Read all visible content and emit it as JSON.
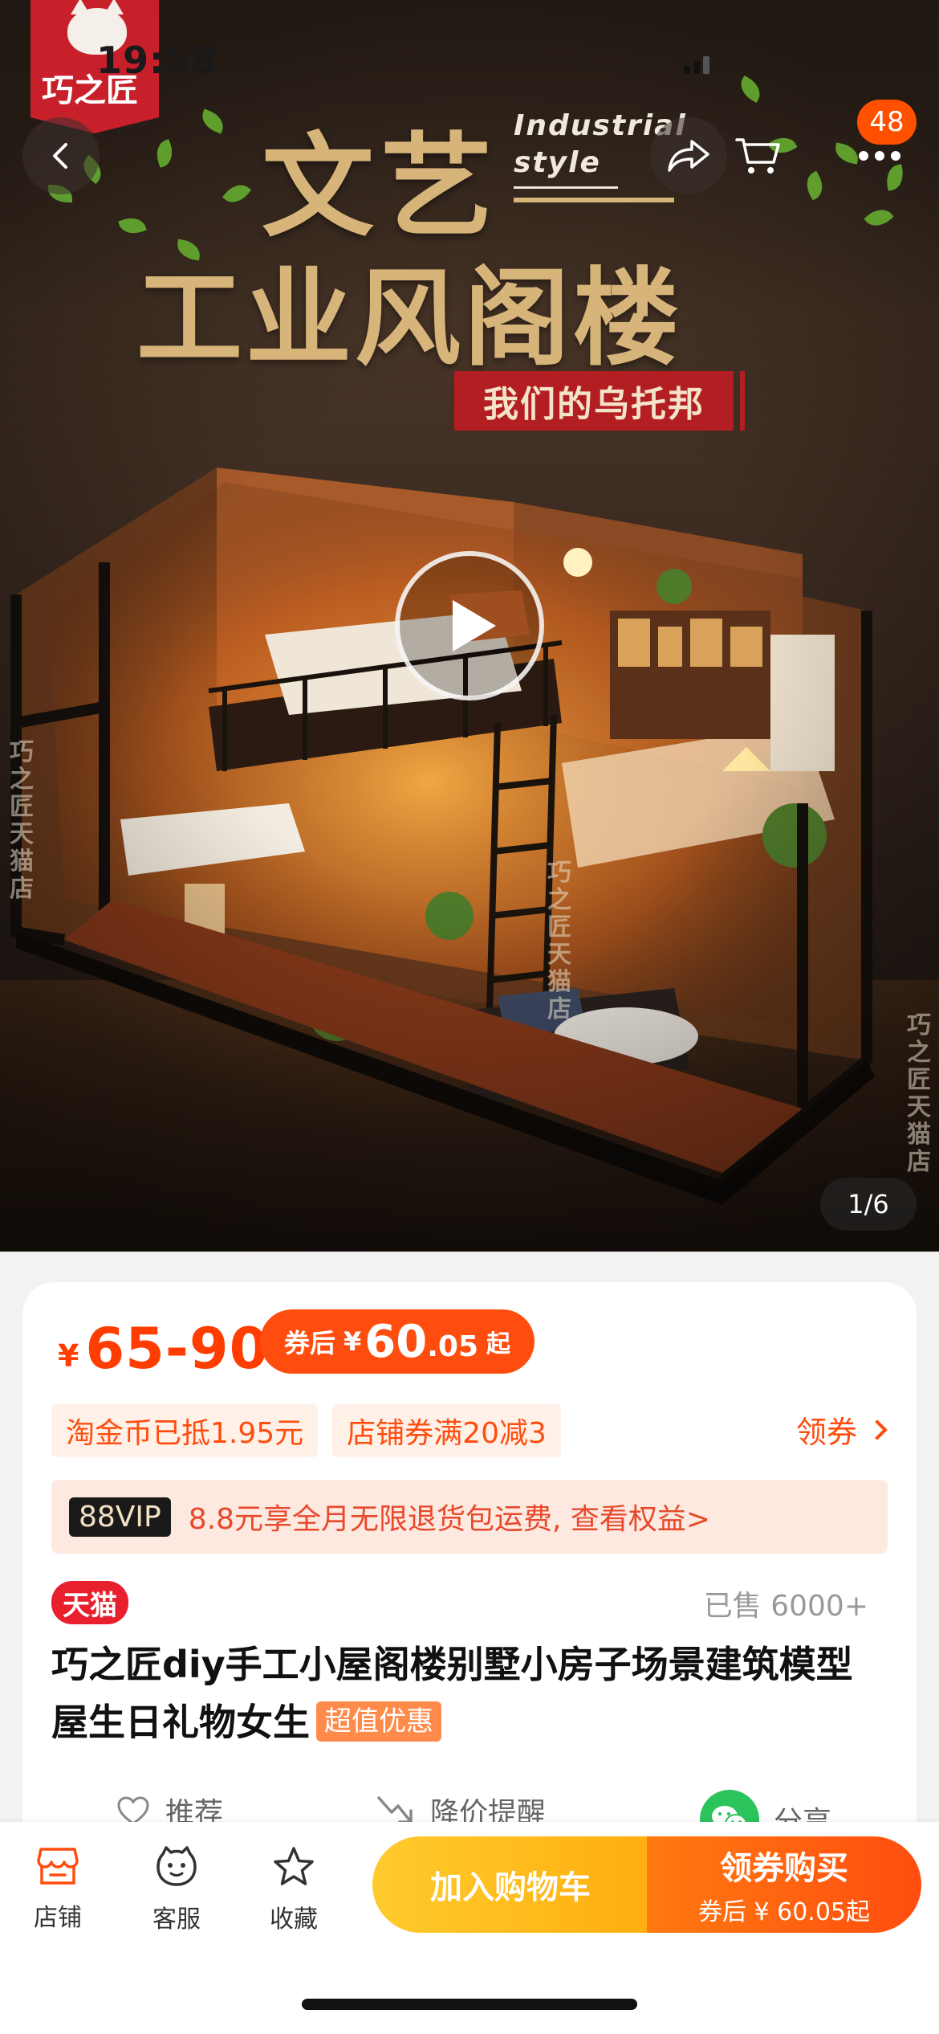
{
  "status_bar": {
    "time": "19:58"
  },
  "store_logo": {
    "text": "巧之匠"
  },
  "header": {
    "cart_count": "48"
  },
  "hero": {
    "title_line1": "文艺",
    "title_en_line1": "Industrial",
    "title_en_line2": "style",
    "title_line2": "工业风阁楼",
    "subtitle": "我们的乌托邦",
    "watermark": "巧之匠天猫店",
    "image_counter": "1/6"
  },
  "price": {
    "currency": "¥",
    "range": "65-90",
    "coupon_label": "券后",
    "coupon_currency": "¥",
    "coupon_int": "60",
    "coupon_dec": ".05",
    "coupon_suffix": "起"
  },
  "tags": {
    "coin": "淘金币已抵1.95元",
    "store_coupon": "店铺券满20减3",
    "get_coupon": "领券"
  },
  "vip": {
    "badge": "88VIP",
    "text": "8.8元享全月无限退货包运费, 查看权益>"
  },
  "product": {
    "platform_tag": "天猫",
    "sold": "已售 6000+",
    "title": "巧之匠diy手工小屋阁楼别墅小房子场景建筑模型屋生日礼物女生",
    "promo_chip": "超值优惠"
  },
  "actions": {
    "recommend": "推荐",
    "price_alert": "降价提醒",
    "share": "分享"
  },
  "bottom_nav": {
    "store": "店铺",
    "service": "客服",
    "favorite": "收藏",
    "add_cart": "加入购物车",
    "buy_main": "领券购买",
    "buy_sub": "券后 ¥ 60.05起"
  },
  "colors": {
    "accent": "#ff4d0f",
    "price_red": "#ff3d00",
    "tmall_red": "#e8202e",
    "cart_yellow": "#ffb300",
    "wechat_green": "#2bc35c"
  }
}
